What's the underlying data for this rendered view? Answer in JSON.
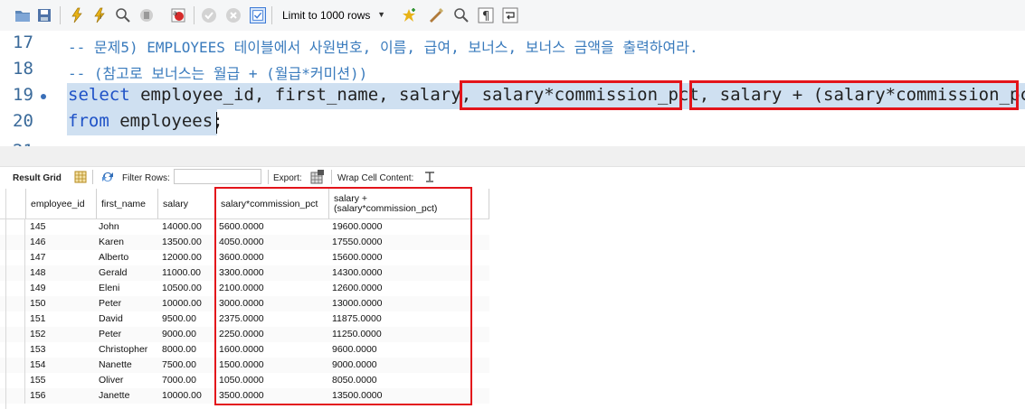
{
  "toolbar": {
    "limit_label": "Limit to 1000 rows",
    "icons": [
      "open-folder-icon",
      "save-icon",
      "execute-icon",
      "execute-current-icon",
      "explain-icon",
      "stop-icon",
      "toggle-error-icon",
      "commit-icon",
      "rollback-icon",
      "autocommit-icon",
      "add-snippet-icon",
      "beautify-icon",
      "find-icon",
      "invisible-chars-icon",
      "wrap-icon"
    ]
  },
  "editor": {
    "lines": [
      {
        "num": "17",
        "text": "-- 문제5) EMPLOYEES 테이블에서 사원번호, 이름, 급여, 보너스, 보너스 금액을 출력하여라."
      },
      {
        "num": "18",
        "text": "-- (참고로 보너스는 월급 + (월급*커미션))"
      },
      {
        "num": "19",
        "kw": "select",
        "rest": " employee_id, first_name, salary, salary*commission_pct, salary + (salary*commission_pct)"
      },
      {
        "num": "20",
        "kw": "from",
        "rest": " employees;"
      },
      {
        "num": "21",
        "text": ""
      }
    ]
  },
  "result_toolbar": {
    "result_grid": "Result Grid",
    "filter_rows": "Filter Rows:",
    "export": "Export:",
    "wrap_cell": "Wrap Cell Content:"
  },
  "grid": {
    "columns": [
      "employee_id",
      "first_name",
      "salary",
      "salary*commission_pct",
      "salary +",
      "(salary*commission_pct)"
    ],
    "rows": [
      [
        "145",
        "John",
        "14000.00",
        "5600.0000",
        "19600.0000"
      ],
      [
        "146",
        "Karen",
        "13500.00",
        "4050.0000",
        "17550.0000"
      ],
      [
        "147",
        "Alberto",
        "12000.00",
        "3600.0000",
        "15600.0000"
      ],
      [
        "148",
        "Gerald",
        "11000.00",
        "3300.0000",
        "14300.0000"
      ],
      [
        "149",
        "Eleni",
        "10500.00",
        "2100.0000",
        "12600.0000"
      ],
      [
        "150",
        "Peter",
        "10000.00",
        "3000.0000",
        "13000.0000"
      ],
      [
        "151",
        "David",
        "9500.00",
        "2375.0000",
        "11875.0000"
      ],
      [
        "152",
        "Peter",
        "9000.00",
        "2250.0000",
        "11250.0000"
      ],
      [
        "153",
        "Christopher",
        "8000.00",
        "1600.0000",
        "9600.0000"
      ],
      [
        "154",
        "Nanette",
        "7500.00",
        "1500.0000",
        "9000.0000"
      ],
      [
        "155",
        "Oliver",
        "7000.00",
        "1050.0000",
        "8050.0000"
      ],
      [
        "156",
        "Janette",
        "10000.00",
        "3500.0000",
        "13500.0000"
      ]
    ]
  },
  "colors": {
    "highlight_red": "#e3141b",
    "selection": "#cfe0f1",
    "keyword": "#1f52c7",
    "comment": "#3a7bbd"
  }
}
